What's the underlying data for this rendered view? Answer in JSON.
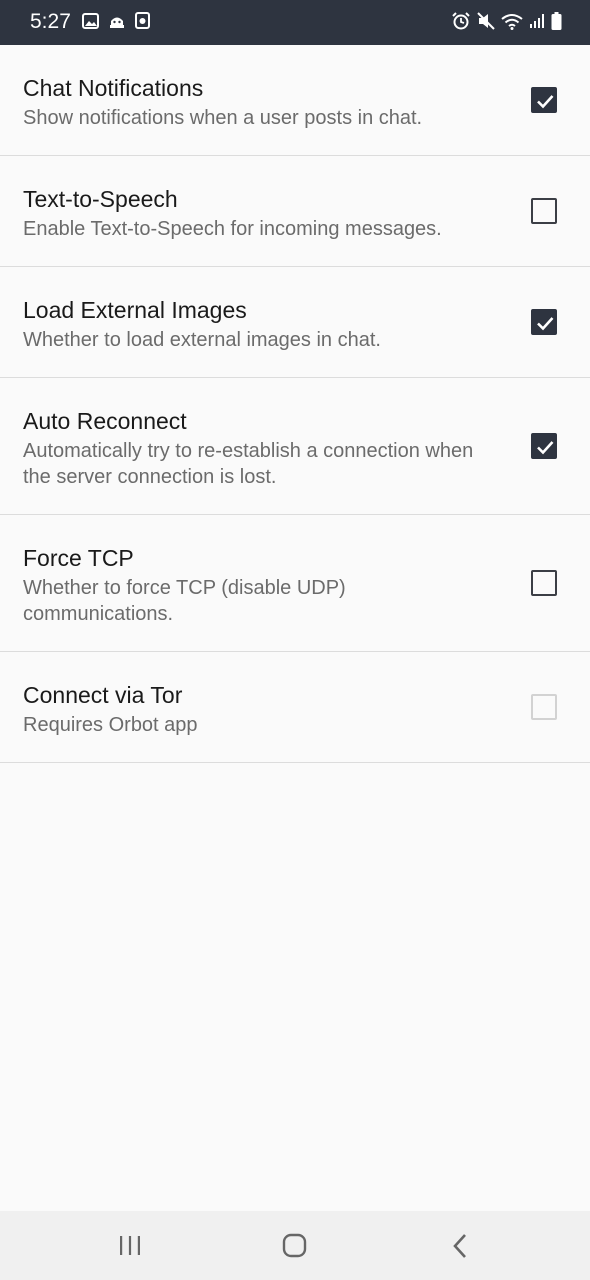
{
  "status_bar": {
    "time": "5:27",
    "left_icons": [
      "image-icon",
      "robot-icon",
      "camera-icon"
    ],
    "right_icons": [
      "alarm-icon",
      "mute-icon",
      "wifi-icon",
      "signal-icon",
      "battery-icon"
    ]
  },
  "settings": [
    {
      "title": "Chat Notifications",
      "summary": "Show notifications when a user posts in chat.",
      "checked": true,
      "enabled": true
    },
    {
      "title": "Text-to-Speech",
      "summary": "Enable Text-to-Speech for incoming messages.",
      "checked": false,
      "enabled": true
    },
    {
      "title": "Load External Images",
      "summary": "Whether to load external images in chat.",
      "checked": true,
      "enabled": true
    },
    {
      "title": "Auto Reconnect",
      "summary": "Automatically try to re-establish a connection when the server connection is lost.",
      "checked": true,
      "enabled": true
    },
    {
      "title": "Force TCP",
      "summary": "Whether to force TCP (disable UDP) communications.",
      "checked": false,
      "enabled": true
    },
    {
      "title": "Connect via Tor",
      "summary": "Requires Orbot app",
      "checked": false,
      "enabled": false
    }
  ],
  "colors": {
    "status_bar": "#2e3440",
    "checkbox_checked": "#2e3440",
    "background": "#fafafa"
  },
  "nav_bar": {
    "icons": [
      "recent-apps-icon",
      "home-icon",
      "back-icon"
    ]
  }
}
